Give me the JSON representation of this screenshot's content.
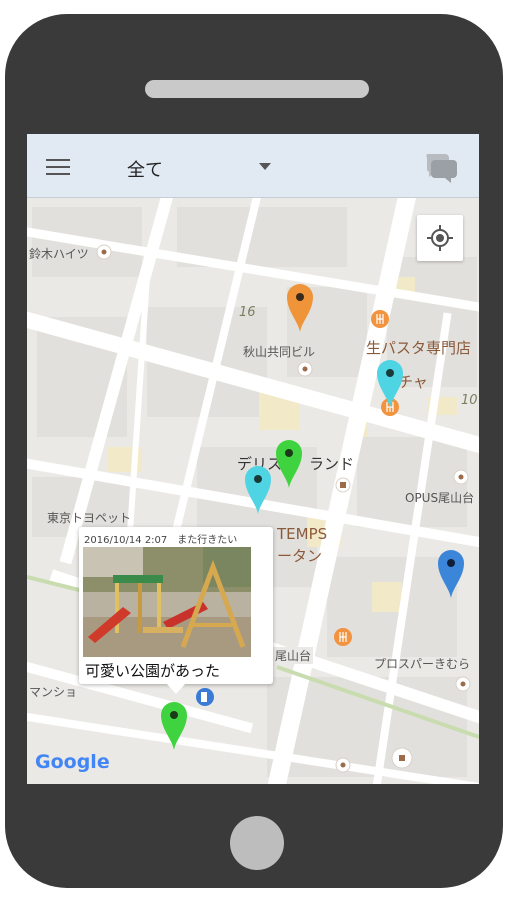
{
  "app": {
    "filter": {
      "selected": "全て"
    },
    "icons": {
      "menu": "hamburger-menu-icon",
      "dropdown": "triangle-down-icon",
      "chat": "chat-bubbles-icon",
      "locate": "crosshair-location-icon"
    }
  },
  "map": {
    "labels": {
      "suzuki": "鈴木ハイツ",
      "block_number": "16",
      "akiyama": "秋山共同ビル",
      "pasta": "生パスタ専門店",
      "chacha": "チャ",
      "ten": "10",
      "deli": "デリス",
      "land": "ランド",
      "tokyo_toyopet": "東京トヨペット",
      "opus": "OPUS尾山台",
      "temps": "TEMPS",
      "tan": "ータン",
      "oyama": "尾山台",
      "prosper": "プロスパーきむら",
      "mansion": "マンショ"
    },
    "callout": {
      "meta": "2016/10/14  2:07　また行きたい",
      "text": "可愛い公園があった"
    },
    "pins": [
      {
        "name": "orange-pin",
        "color": "#f0943a"
      },
      {
        "name": "cyan-pin-1",
        "color": "#4fd4e4"
      },
      {
        "name": "cyan-pin-2",
        "color": "#4fd4e4"
      },
      {
        "name": "green-pin-1",
        "color": "#3fd43f"
      },
      {
        "name": "green-pin-2",
        "color": "#3fd43f"
      },
      {
        "name": "blue-pin",
        "color": "#3b86d8"
      }
    ],
    "attribution": "Google"
  }
}
